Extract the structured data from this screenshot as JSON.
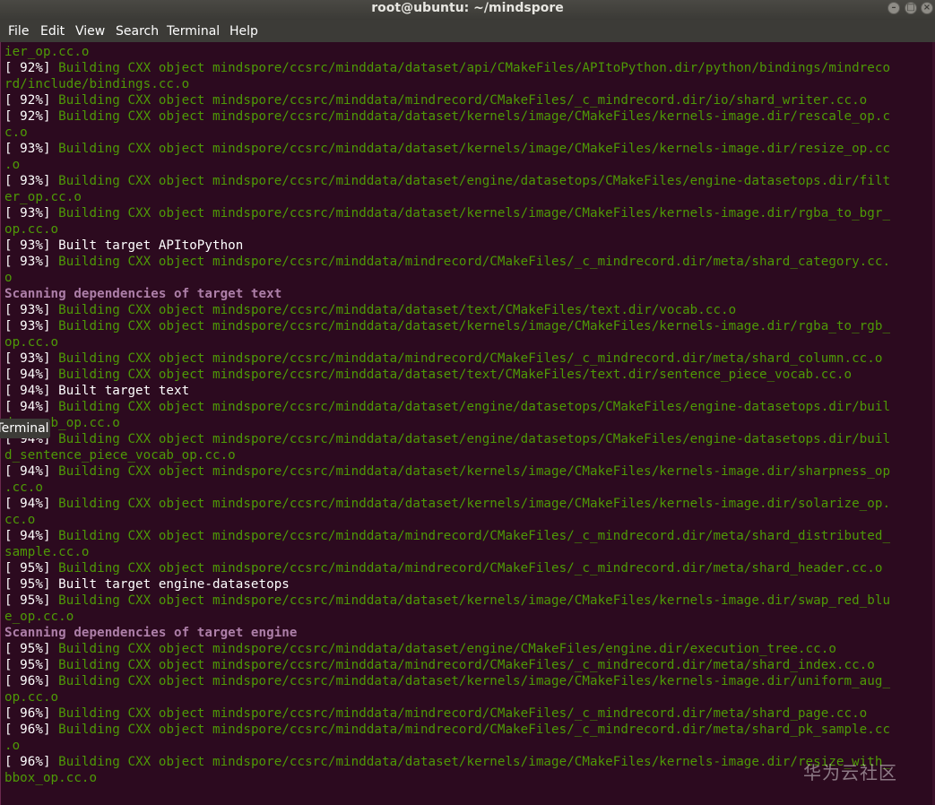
{
  "window": {
    "title": "root@ubuntu: ~/mindspore"
  },
  "menubar": {
    "items": [
      "File",
      "Edit",
      "View",
      "Search",
      "Terminal",
      "Help"
    ]
  },
  "tooltip": "Terminal",
  "watermark": "华为云社区",
  "colors": {
    "background": "#2c0a1f",
    "build_green": "#4e9a06",
    "scan_magenta": "#ad7fa8",
    "text_white": "#ffffff",
    "menubar": "#3c3b37"
  },
  "terminal": {
    "lines": [
      {
        "style": "g",
        "text": "ier_op.cc.o"
      },
      {
        "style": "w",
        "text": "[ 92%] ",
        "rest": "Building CXX object mindspore/ccsrc/minddata/dataset/api/CMakeFiles/APItoPython.dir/python/bindings/mindreco"
      },
      {
        "style": "g",
        "text": "rd/include/bindings.cc.o"
      },
      {
        "style": "w",
        "text": "[ 92%] ",
        "rest": "Building CXX object mindspore/ccsrc/minddata/mindrecord/CMakeFiles/_c_mindrecord.dir/io/shard_writer.cc.o"
      },
      {
        "style": "w",
        "text": "[ 92%] ",
        "rest": "Building CXX object mindspore/ccsrc/minddata/dataset/kernels/image/CMakeFiles/kernels-image.dir/rescale_op.c"
      },
      {
        "style": "g",
        "text": "c.o"
      },
      {
        "style": "w",
        "text": "[ 93%] ",
        "rest": "Building CXX object mindspore/ccsrc/minddata/dataset/kernels/image/CMakeFiles/kernels-image.dir/resize_op.cc"
      },
      {
        "style": "g",
        "text": ".o"
      },
      {
        "style": "w",
        "text": "[ 93%] ",
        "rest": "Building CXX object mindspore/ccsrc/minddata/dataset/engine/datasetops/CMakeFiles/engine-datasetops.dir/filt"
      },
      {
        "style": "g",
        "text": "er_op.cc.o"
      },
      {
        "style": "w",
        "text": "[ 93%] ",
        "rest": "Building CXX object mindspore/ccsrc/minddata/dataset/kernels/image/CMakeFiles/kernels-image.dir/rgba_to_bgr_"
      },
      {
        "style": "g",
        "text": "op.cc.o"
      },
      {
        "style": "w",
        "text": "[ 93%] Built target APItoPython"
      },
      {
        "style": "w",
        "text": "[ 93%] ",
        "rest": "Building CXX object mindspore/ccsrc/minddata/mindrecord/CMakeFiles/_c_mindrecord.dir/meta/shard_category.cc."
      },
      {
        "style": "g",
        "text": "o"
      },
      {
        "style": "m",
        "text": "Scanning dependencies of target text"
      },
      {
        "style": "w",
        "text": "[ 93%] ",
        "rest": "Building CXX object mindspore/ccsrc/minddata/dataset/text/CMakeFiles/text.dir/vocab.cc.o"
      },
      {
        "style": "w",
        "text": "[ 93%] ",
        "rest": "Building CXX object mindspore/ccsrc/minddata/dataset/kernels/image/CMakeFiles/kernels-image.dir/rgba_to_rgb_"
      },
      {
        "style": "g",
        "text": "op.cc.o"
      },
      {
        "style": "w",
        "text": "[ 93%] ",
        "rest": "Building CXX object mindspore/ccsrc/minddata/mindrecord/CMakeFiles/_c_mindrecord.dir/meta/shard_column.cc.o"
      },
      {
        "style": "w",
        "text": "[ 94%] ",
        "rest": "Building CXX object mindspore/ccsrc/minddata/dataset/text/CMakeFiles/text.dir/sentence_piece_vocab.cc.o"
      },
      {
        "style": "w",
        "text": "[ 94%] Built target text"
      },
      {
        "style": "w",
        "text": "[ 94%] ",
        "rest": "Building CXX object mindspore/ccsrc/minddata/dataset/engine/datasetops/CMakeFiles/engine-datasetops.dir/buil"
      },
      {
        "style": "g",
        "text": "d_vocab_op.cc.o"
      },
      {
        "style": "w",
        "text": "[ 94%] ",
        "rest": "Building CXX object mindspore/ccsrc/minddata/dataset/engine/datasetops/CMakeFiles/engine-datasetops.dir/buil"
      },
      {
        "style": "g",
        "text": "d_sentence_piece_vocab_op.cc.o"
      },
      {
        "style": "w",
        "text": "[ 94%] ",
        "rest": "Building CXX object mindspore/ccsrc/minddata/dataset/kernels/image/CMakeFiles/kernels-image.dir/sharpness_op"
      },
      {
        "style": "g",
        "text": ".cc.o"
      },
      {
        "style": "w",
        "text": "[ 94%] ",
        "rest": "Building CXX object mindspore/ccsrc/minddata/dataset/kernels/image/CMakeFiles/kernels-image.dir/solarize_op."
      },
      {
        "style": "g",
        "text": "cc.o"
      },
      {
        "style": "w",
        "text": "[ 94%] ",
        "rest": "Building CXX object mindspore/ccsrc/minddata/mindrecord/CMakeFiles/_c_mindrecord.dir/meta/shard_distributed_"
      },
      {
        "style": "g",
        "text": "sample.cc.o"
      },
      {
        "style": "w",
        "text": "[ 95%] ",
        "rest": "Building CXX object mindspore/ccsrc/minddata/mindrecord/CMakeFiles/_c_mindrecord.dir/meta/shard_header.cc.o"
      },
      {
        "style": "w",
        "text": "[ 95%] Built target engine-datasetops"
      },
      {
        "style": "w",
        "text": "[ 95%] ",
        "rest": "Building CXX object mindspore/ccsrc/minddata/dataset/kernels/image/CMakeFiles/kernels-image.dir/swap_red_blu"
      },
      {
        "style": "g",
        "text": "e_op.cc.o"
      },
      {
        "style": "m",
        "text": "Scanning dependencies of target engine"
      },
      {
        "style": "w",
        "text": "[ 95%] ",
        "rest": "Building CXX object mindspore/ccsrc/minddata/dataset/engine/CMakeFiles/engine.dir/execution_tree.cc.o"
      },
      {
        "style": "w",
        "text": "[ 95%] ",
        "rest": "Building CXX object mindspore/ccsrc/minddata/mindrecord/CMakeFiles/_c_mindrecord.dir/meta/shard_index.cc.o"
      },
      {
        "style": "w",
        "text": "[ 96%] ",
        "rest": "Building CXX object mindspore/ccsrc/minddata/dataset/kernels/image/CMakeFiles/kernels-image.dir/uniform_aug_"
      },
      {
        "style": "g",
        "text": "op.cc.o"
      },
      {
        "style": "w",
        "text": "[ 96%] ",
        "rest": "Building CXX object mindspore/ccsrc/minddata/mindrecord/CMakeFiles/_c_mindrecord.dir/meta/shard_page.cc.o"
      },
      {
        "style": "w",
        "text": "[ 96%] ",
        "rest": "Building CXX object mindspore/ccsrc/minddata/mindrecord/CMakeFiles/_c_mindrecord.dir/meta/shard_pk_sample.cc"
      },
      {
        "style": "g",
        "text": ".o"
      },
      {
        "style": "w",
        "text": "[ 96%] ",
        "rest": "Building CXX object mindspore/ccsrc/minddata/dataset/kernels/image/CMakeFiles/kernels-image.dir/resize_with_"
      },
      {
        "style": "g",
        "text": "bbox_op.cc.o"
      }
    ]
  }
}
